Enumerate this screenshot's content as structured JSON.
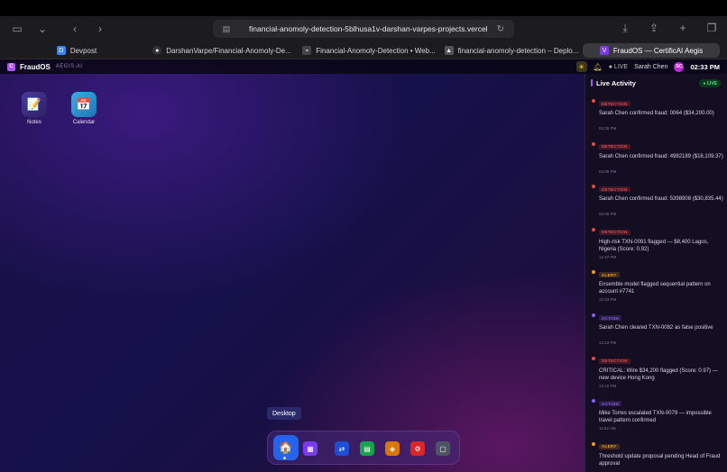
{
  "browser": {
    "url": "financial-anomoly-detection-5blhusa1v-darshan-varpes-projects.vercel.app",
    "tabs": [
      {
        "label": "Devpost",
        "icon": "devpost-icon",
        "color": "#3b82f6"
      },
      {
        "label": "DarshanVarpe/Financial-Anomoly-De...",
        "icon": "github-icon",
        "color": "#444"
      },
      {
        "label": "Financial-Anomoly-Detection  •  Web...",
        "icon": "deploy-icon",
        "color": "#555"
      },
      {
        "label": "financial-anomoly-detection – Deplo...",
        "icon": "vercel-icon",
        "color": "#555"
      },
      {
        "label": "FraudOS — CertificAI Aegis",
        "icon": "fraudos-icon",
        "color": "#7c3aed"
      }
    ]
  },
  "status": {
    "brand": "FraudOS",
    "brand_sub": "AEGIS.AI",
    "live": "● LIVE",
    "user": "Sarah Chen",
    "avatar": "SC",
    "clock": "02:33 PM"
  },
  "desktop": {
    "icons": [
      {
        "label": "Notes",
        "glyph": "📝"
      },
      {
        "label": "Calendar",
        "glyph": "📅"
      }
    ]
  },
  "dock": {
    "tooltip": "Desktop",
    "items": [
      {
        "name": "desktop-dock-icon",
        "glyph": "🏠",
        "color": "#2563eb"
      },
      {
        "name": "apps-grid-dock-icon",
        "glyph": "▦",
        "color": "#7c3aed"
      },
      {
        "name": "transfer-dock-icon",
        "glyph": "⇄",
        "color": "#1d4ed8"
      },
      {
        "name": "reports-dock-icon",
        "glyph": "▤",
        "color": "#16a34a"
      },
      {
        "name": "alerts-dock-icon",
        "glyph": "◈",
        "color": "#d97706"
      },
      {
        "name": "settings-dock-icon",
        "glyph": "⚙",
        "color": "#dc2626"
      },
      {
        "name": "notes-dock-icon",
        "glyph": "▢",
        "color": "#6b7280"
      }
    ]
  },
  "activity": {
    "title": "Live Activity",
    "badge": "● LIVE",
    "colors": {
      "DETECTION": "#ef4444",
      "ALERT": "#f59e0b",
      "ACTION": "#8b5cf6"
    },
    "items": [
      {
        "type": "DETECTION",
        "text": "Sarah Chen confirmed fraud: 0064 ($34,200.00)",
        "time": "02:05 PM"
      },
      {
        "type": "DETECTION",
        "text": "Sarah Chen confirmed fraud: 4982189 ($16,109.37)",
        "time": "02:05 PM"
      },
      {
        "type": "DETECTION",
        "text": "Sarah Chen confirmed fraud: 5398908 ($30,835.44)",
        "time": "02:05 PM"
      },
      {
        "type": "DETECTION",
        "text": "High-risk TXN-0091 flagged — $8,400 Lagos, Nigeria (Score: 0.92)",
        "time": "12:37 PM"
      },
      {
        "type": "ALERT",
        "text": "Ensemble model flagged sequential pattern on account #7741",
        "time": "12:33 PM"
      },
      {
        "type": "ACTION",
        "text": "Sarah Chen cleared TXN-0082 as false positive",
        "time": "12:23 PM"
      },
      {
        "type": "DETECTION",
        "text": "CRITICAL: Wire $34,200 flagged (Score: 0.97) — new device Hong Kong",
        "time": "12:16 PM"
      },
      {
        "type": "ACTION",
        "text": "Mike Torres escalated TXN-0079 — impossible travel pattern confirmed",
        "time": "11:52 AM"
      },
      {
        "type": "ALERT",
        "text": "Threshold update proposal pending Head of Fraud approval",
        "time": ""
      }
    ]
  }
}
